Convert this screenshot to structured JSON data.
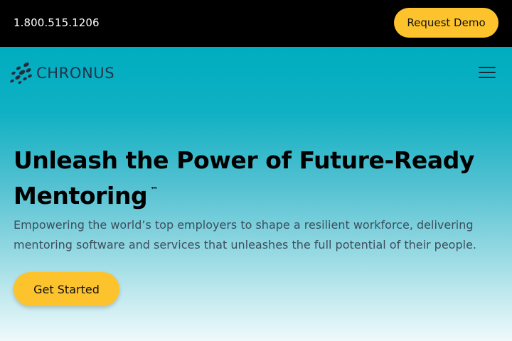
{
  "topbar": {
    "phone": "1.800.515.1206",
    "demo_label": "Request Demo"
  },
  "header": {
    "logo_text": "CHRONUS",
    "menu_icon": "hamburger-menu-icon"
  },
  "hero": {
    "headline": "Unleash the Power of Future-Ready Mentoring",
    "trademark": "™",
    "subtext": "Empowering the world’s top employers to shape a resilient workforce, delivering mentoring software and services that unleashes the full potential of their people.",
    "cta_label": "Get Started"
  },
  "colors": {
    "topbar_bg": "#000000",
    "accent_yellow": "#fcc32d",
    "hero_teal": "#00adc0",
    "logo_text": "#23344a"
  }
}
